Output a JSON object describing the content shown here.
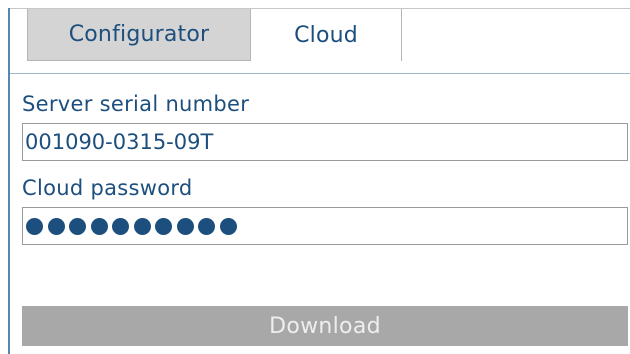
{
  "tabs": [
    {
      "label": "Configurator",
      "active": false
    },
    {
      "label": "Cloud",
      "active": true
    }
  ],
  "form": {
    "serial_label": "Server serial number",
    "serial_value": "001090-0315-09T",
    "password_label": "Cloud password",
    "password_masked_length": 10,
    "download_label": "Download"
  },
  "colors": {
    "text": "#1d4f7e",
    "inactive_tab_bg": "#d4d4d4",
    "button_bg": "#a8a8a8",
    "button_text": "#eeeeee",
    "frame_left_border": "#5a86ad"
  }
}
